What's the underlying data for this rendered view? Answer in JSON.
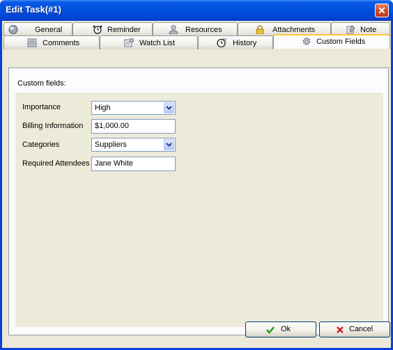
{
  "window": {
    "title": "Edit Task(#1)",
    "close_glyph": "✕"
  },
  "tabs_row1": [
    {
      "label": "General",
      "icon": "globe-icon"
    },
    {
      "label": "Reminder",
      "icon": "alarm-clock-icon"
    },
    {
      "label": "Resources",
      "icon": "person-icon"
    },
    {
      "label": "Attachments",
      "icon": "padlock-icon"
    },
    {
      "label": "Note",
      "icon": "note-icon"
    }
  ],
  "tabs_row2": [
    {
      "label": "Comments",
      "icon": "comments-icon"
    },
    {
      "label": "Watch List",
      "icon": "watch-list-icon"
    },
    {
      "label": "History",
      "icon": "history-icon"
    },
    {
      "label": "Custom Fields",
      "icon": "gear-icon",
      "active": true
    }
  ],
  "page": {
    "heading": "Custom fields:",
    "fields": {
      "importance": {
        "label": "Importance",
        "value": "High"
      },
      "billing": {
        "label": "Billing Information",
        "value": "$1,000.00"
      },
      "categories": {
        "label": "Categories",
        "value": "Suppliers"
      },
      "attendees": {
        "label": "Required Attendees",
        "value": "Jane White"
      }
    }
  },
  "buttons": {
    "ok": {
      "label": "Ok",
      "icon": "checkmark-icon"
    },
    "cancel": {
      "label": "Cancel",
      "icon": "x-icon"
    }
  },
  "colors": {
    "titlebar": "#0050e0",
    "dialog_bg": "#ece9d8",
    "panel_bg": "#ecead9",
    "active_tab_accent": "#ffc83c"
  }
}
